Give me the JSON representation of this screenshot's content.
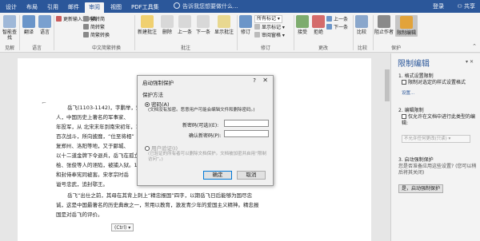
{
  "tabs": [
    "设计",
    "布局",
    "引用",
    "邮件",
    "审阅",
    "视图",
    "PDF工具集"
  ],
  "active_tab": "审阅",
  "tell_me": "告诉我您想要做什么...",
  "login": "登录",
  "share": "共享",
  "ribbon": {
    "proofing": {
      "smart_lookup": "智能查找",
      "label": "见解"
    },
    "translate": "翻译",
    "language": {
      "label": "语言",
      "group": "语言"
    },
    "chinese": {
      "update_ime": "更新输入法词典",
      "to_trad": "繁转简",
      "to_simp": "简转繁",
      "conv": "简繁转换",
      "group": "中文简繁转换"
    },
    "comments": {
      "new": "新建批注",
      "delete": "删除",
      "prev": "上一条",
      "next": "下一条",
      "show": "显示批注",
      "group": "批注"
    },
    "tracking": {
      "track": "修订",
      "markup": "所有标记",
      "show_markup": "显示标记",
      "pane": "审阅窗格",
      "group": "修订"
    },
    "changes": {
      "accept": "接受",
      "reject": "拒绝",
      "prev": "上一条",
      "next": "下一条",
      "group": "更改"
    },
    "compare": {
      "label": "比较",
      "group": "比较"
    },
    "protect": {
      "block": "阻止作者",
      "restrict": "限制编辑",
      "group": "保护"
    }
  },
  "document": {
    "para1": [
      "岳飞(1103-1142)，字鹏举，宋相",
      "人，中国历史上著名的军事家、",
      "年投军，从 北宋末年到南宋初年，1141",
      "百次战斗，所向披靡，“位至将相”",
      "复郑州、洛阳等地，又于郾城、",
      "以十二道金牌下令退兵，岳飞在孤立",
      "桧、张俊等人的诬陷，被捕入狱。114",
      "和封侍奉宪同被害。宋孝宗时岳",
      "谥号忠武，追封鄂王。"
    ],
    "para2": [
      "岳飞“出仕之前，其母在其背上刺上“精忠报国”四字，以期岳飞日后能够为国尽忠",
      "诚，这是中国最著名的历史典故之一，常用以教育，激发青少年的爱国主义精神。精忠报",
      "国是对岳飞的评价。"
    ],
    "ctrl": "(Ctrl) ▾"
  },
  "dialog": {
    "title": "启动强制保护",
    "help": "?",
    "close": "✕",
    "section": "保护方法",
    "password_option": "密码(A)",
    "password_note": "(文档没有加密。恶意用户可能会编辑文件和删除密码。)",
    "new_password_label": "新密码(可选)(E):",
    "confirm_password_label": "确认新密码(P):",
    "user_auth_option": "用户验证(I)",
    "user_auth_note": "(已验证的所有者可以删除文档保护。文档被加密并启用“限制访问”。)",
    "ok": "确定",
    "cancel": "取消"
  },
  "pane": {
    "title": "限制编辑",
    "controls": "▾ ✕",
    "s1_head": "1. 格式设置限制",
    "s1_check": "限制对选定的样式设置格式",
    "s1_link": "设置...",
    "s2_head": "2. 编辑限制",
    "s2_check": "仅允许在文档中进行此类型的编辑:",
    "s2_select": "不允许任何更改(只读)",
    "s3_head": "3. 启动强制保护",
    "s3_question": "您是否准备应用这些设置? (您可以稍后将其关闭)",
    "s3_button": "是，启动强制保护"
  },
  "colors": {
    "brand": "#2b579a",
    "ribbon_bg": "#f3f3f3",
    "doc_bg": "#e6e6e6"
  }
}
